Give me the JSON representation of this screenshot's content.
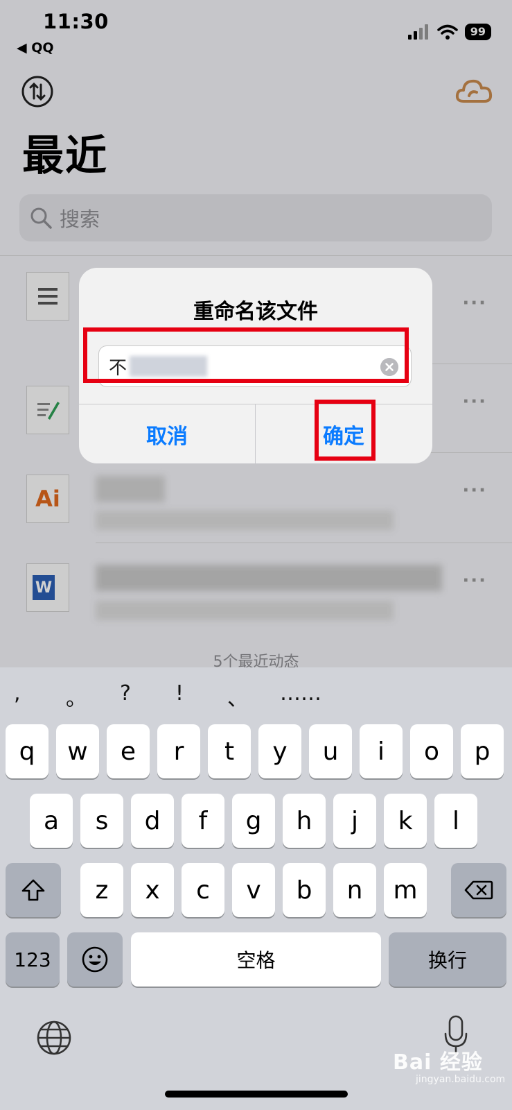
{
  "status_bar": {
    "time": "11:30",
    "back_label": "◀ QQ",
    "battery": "99"
  },
  "header": {
    "title": "最近"
  },
  "search": {
    "placeholder": "搜索"
  },
  "files": [
    {
      "icon_text": "",
      "name": "",
      "meta": ""
    },
    {
      "icon_text": "",
      "name": "",
      "meta": ""
    },
    {
      "icon_text": "Ai",
      "name": "",
      "meta": ""
    },
    {
      "icon_text": "W",
      "name": "",
      "meta": ""
    }
  ],
  "footer": {
    "count": "5个最近动态"
  },
  "dialog": {
    "title": "重命名该文件",
    "input_value": "不",
    "cancel_label": "取消",
    "confirm_label": "确定"
  },
  "keyboard": {
    "punctuation": [
      ",",
      "。",
      "?",
      "!",
      "、",
      "……"
    ],
    "row1": [
      "q",
      "w",
      "e",
      "r",
      "t",
      "y",
      "u",
      "i",
      "o",
      "p"
    ],
    "row2": [
      "a",
      "s",
      "d",
      "f",
      "g",
      "h",
      "j",
      "k",
      "l"
    ],
    "row3": [
      "z",
      "x",
      "c",
      "v",
      "b",
      "n",
      "m"
    ],
    "numbers_label": "123",
    "space_label": "空格",
    "return_label": "换行"
  },
  "watermark": {
    "brand": "Bai 经验",
    "url": "jingyan.baidu.com"
  },
  "colors": {
    "accent": "#0a7bff",
    "highlight": "#e60012",
    "cloud": "#c98a4d"
  }
}
